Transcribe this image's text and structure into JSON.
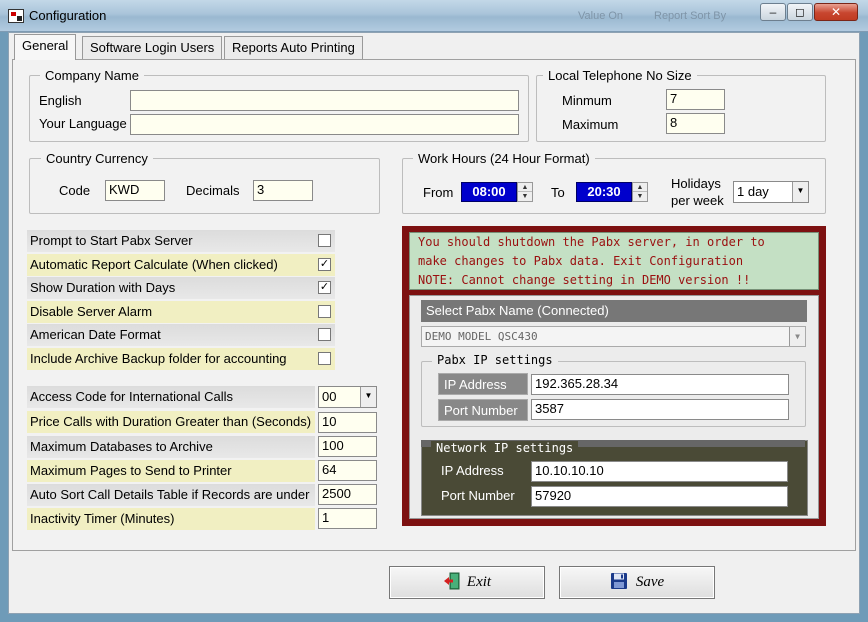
{
  "window": {
    "title": "Configuration",
    "background_labels": [
      "Value On",
      "Report Sort By"
    ],
    "min_glyph": "–",
    "max_glyph": "◻",
    "close_glyph": "✕"
  },
  "tabs": [
    {
      "label": "General",
      "active": true
    },
    {
      "label": "Software Login Users",
      "active": false
    },
    {
      "label": "Reports Auto Printing",
      "active": false
    }
  ],
  "company": {
    "legend": "Company Name",
    "english_label": "English",
    "english_value": "",
    "language_label": "Your Language",
    "language_value": ""
  },
  "telephone": {
    "legend": "Local Telephone No Size",
    "min_label": "Minmum",
    "min_value": "7",
    "max_label": "Maximum",
    "max_value": "8"
  },
  "currency": {
    "legend": "Country Currency",
    "code_label": "Code",
    "code_value": "KWD",
    "decimals_label": "Decimals",
    "decimals_value": "3"
  },
  "work_hours": {
    "legend": "Work Hours (24 Hour Format)",
    "from_label": "From",
    "from_value": "08:00",
    "to_label": "To",
    "to_value": "20:30",
    "holidays_label_1": "Holidays",
    "holidays_label_2": "per week",
    "holidays_value": "1 day"
  },
  "options": [
    {
      "label": "Prompt to Start Pabx Server",
      "checked": false
    },
    {
      "label": "Automatic Report Calculate (When clicked)",
      "checked": true
    },
    {
      "label": "Show Duration with Days",
      "checked": true
    },
    {
      "label": "Disable Server Alarm",
      "checked": false
    },
    {
      "label": "American Date Format",
      "checked": false
    },
    {
      "label": "Include Archive Backup folder for accounting",
      "checked": false
    }
  ],
  "settings": [
    {
      "label": "Access Code for International  Calls",
      "value": "00"
    },
    {
      "label": "Price Calls with Duration Greater than (Seconds)",
      "value": "10"
    },
    {
      "label": "Maximum Databases to Archive",
      "value": "100"
    },
    {
      "label": "Maximum Pages to Send to Printer",
      "value": "64"
    },
    {
      "label": "Auto Sort Call Details Table if Records are under",
      "value": "2500"
    },
    {
      "label": "Inactivity Timer (Minutes)",
      "value": "1"
    }
  ],
  "warning": {
    "line1": "You should shutdown the Pabx server, in order to",
    "line2": "make changes to Pabx data. Exit Configuration",
    "line3": "NOTE: Cannot change setting in DEMO version !!"
  },
  "pabx": {
    "select_label": "Select Pabx Name (Connected)",
    "selected_name": "DEMO MODEL QSC430",
    "ip_legend": "Pabx IP settings",
    "ip_label": "IP Address",
    "ip_value": "192.365.28.34",
    "port_label": "Port Number",
    "port_value": "3587"
  },
  "network": {
    "legend": "Network IP settings",
    "ip_label": "IP Address",
    "ip_value": "10.10.10.10",
    "port_label": "Port Number",
    "port_value": "57920"
  },
  "buttons": {
    "exit": "Exit",
    "save": "Save"
  },
  "colors": {
    "accent_blue": "#0000cc",
    "warning_red": "#7d1111",
    "warning_bg": "#c4e0c4"
  }
}
